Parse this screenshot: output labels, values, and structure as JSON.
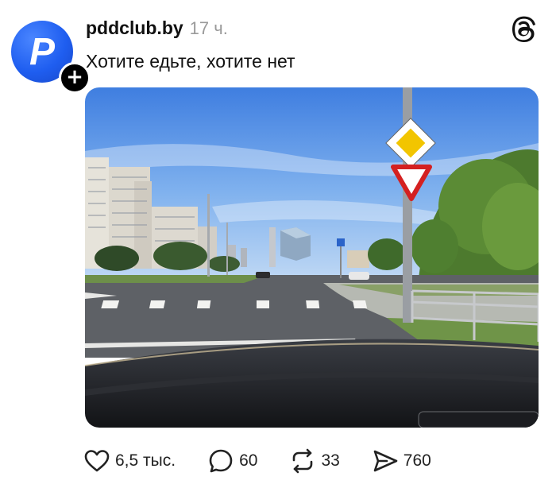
{
  "post": {
    "avatar_letter": "P",
    "follow_badge": "+",
    "username": "pddclub.by",
    "timestamp": "17 ч.",
    "text": "Хотите едьте, хотите нет"
  },
  "actions": {
    "likes": "6,5 тыс.",
    "comments": "60",
    "reposts": "33",
    "shares": "760"
  },
  "colors": {
    "avatar": "#1f5ef0",
    "sky": "#7aaee8",
    "sign_yellow": "#f2c500",
    "sign_red": "#d42020"
  },
  "icons": [
    "threads-logo-icon",
    "heart-icon",
    "comment-icon",
    "repost-icon",
    "share-icon"
  ]
}
